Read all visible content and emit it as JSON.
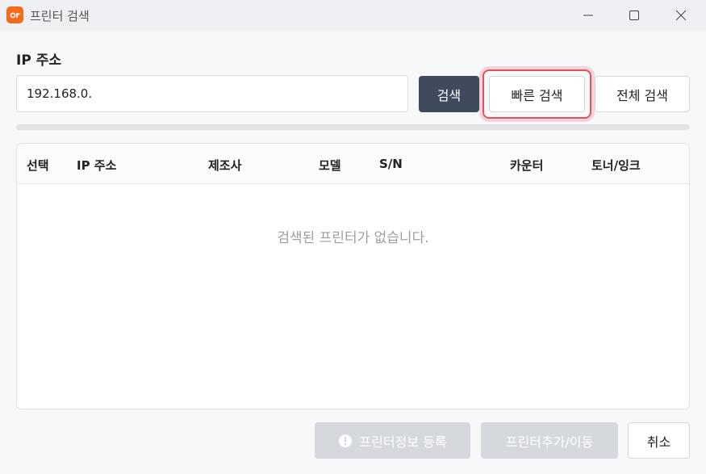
{
  "window": {
    "title": "프린터 검색",
    "app_icon_text": "아이",
    "controls": {
      "minimize": "minimize-icon",
      "maximize": "maximize-icon",
      "close": "close-icon"
    }
  },
  "search": {
    "label": "IP 주소",
    "ip_value": "192.168.0.",
    "search_label": "검색",
    "quick_search_label": "빠른 검색",
    "full_search_label": "전체 검색"
  },
  "progress": {
    "value": 0
  },
  "table": {
    "columns": [
      "선택",
      "IP 주소",
      "제조사",
      "모델",
      "S/N",
      "카운터",
      "토너/잉크"
    ],
    "empty_message": "검색된 프린터가 없습니다."
  },
  "footer": {
    "register_label": "프린터정보 등록",
    "register_icon": "alert-circle-icon",
    "add_move_label": "프린터추가/이동",
    "cancel_label": "취소"
  },
  "colors": {
    "accent": "#3f4b5c",
    "highlight": "#e05060",
    "app_icon": "#f26a1b",
    "disabled": "#d5d8dd"
  }
}
